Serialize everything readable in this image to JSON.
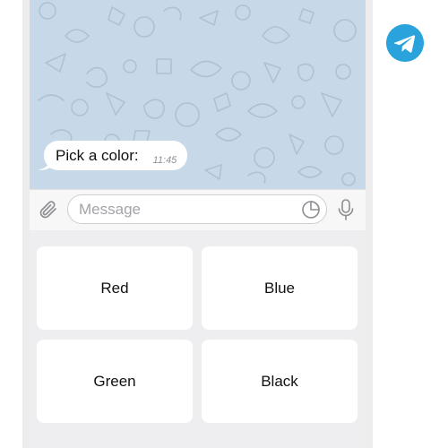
{
  "chat": {
    "message": {
      "text": "Pick a color:",
      "time": "11:45"
    }
  },
  "input": {
    "placeholder": "Message"
  },
  "keyboard": {
    "buttons": [
      {
        "label": "Red"
      },
      {
        "label": "Blue"
      },
      {
        "label": "Green"
      },
      {
        "label": "Black"
      }
    ]
  },
  "colors": {
    "chat_background": "#c7d8e8",
    "telegram_blue": "#2aa3dd",
    "bubble": "#ffffff"
  },
  "icons": [
    "paperclip-icon",
    "sticker-icon",
    "microphone-icon",
    "telegram-logo-icon"
  ]
}
